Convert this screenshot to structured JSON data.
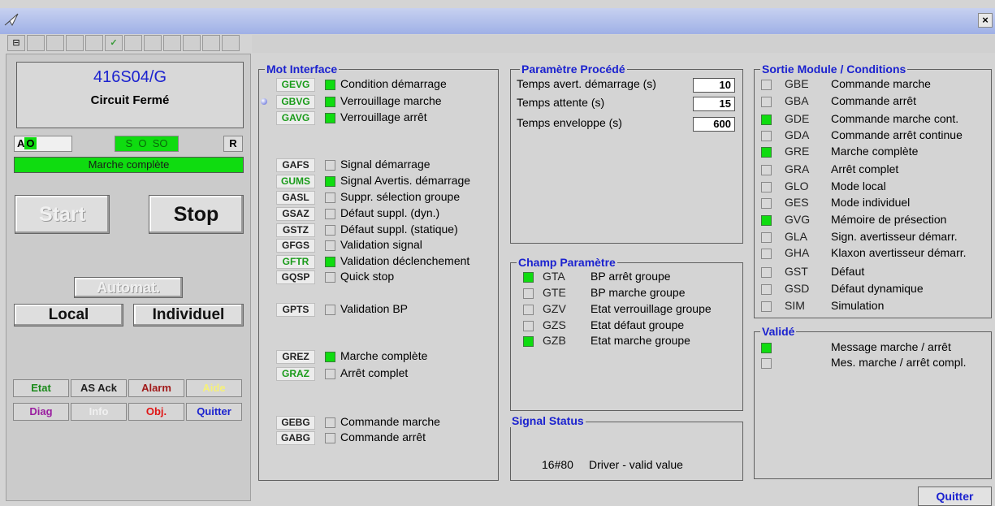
{
  "toolbar": {
    "check_symbol": "✓"
  },
  "left": {
    "title": "416S04/G",
    "subtitle": "Circuit Fermé",
    "ao": {
      "a": "A",
      "o": "O"
    },
    "so": {
      "s": "S",
      "o": "O",
      "so": "SO"
    },
    "r": "R",
    "status": "Marche complète",
    "start": "Start",
    "stop": "Stop",
    "automat": "Automat.",
    "local": "Local",
    "individuel": "Individuel",
    "grid": [
      {
        "label": "Etat",
        "color": "#1a8a1a"
      },
      {
        "label": "AS Ack",
        "color": "#222222"
      },
      {
        "label": "Alarm",
        "color": "#a11b1b"
      },
      {
        "label": "Aide",
        "color": "#f5f07a"
      },
      {
        "label": "Diag",
        "color": "#9a1ea0"
      },
      {
        "label": "Info",
        "color": "#f0f0f0"
      },
      {
        "label": "Obj.",
        "color": "#e01515"
      },
      {
        "label": "Quitter",
        "color": "#1b22cf"
      }
    ]
  },
  "mot": {
    "title": "Mot Interface",
    "rows": [
      {
        "code": "GEVG",
        "green": true,
        "checked": true,
        "label": "Condition démarrage"
      },
      {
        "code": "GBVG",
        "green": true,
        "checked": true,
        "label": "Verrouillage marche"
      },
      {
        "code": "GAVG",
        "green": true,
        "checked": true,
        "label": "Verrouillage arrêt"
      },
      {
        "code": "GAFS",
        "green": false,
        "checked": false,
        "label": "Signal démarrage"
      },
      {
        "code": "GUMS",
        "green": true,
        "checked": true,
        "label": "Signal Avertis. démarrage"
      },
      {
        "code": "GASL",
        "green": false,
        "checked": false,
        "label": "Suppr. sélection groupe"
      },
      {
        "code": "GSAZ",
        "green": false,
        "checked": false,
        "label": "Défaut suppl. (dyn.)"
      },
      {
        "code": "GSTZ",
        "green": false,
        "checked": false,
        "label": "Défaut suppl. (statique)"
      },
      {
        "code": "GFGS",
        "green": false,
        "checked": false,
        "label": "Validation signal"
      },
      {
        "code": "GFTR",
        "green": true,
        "checked": true,
        "label": "Validation déclenchement"
      },
      {
        "code": "GQSP",
        "green": false,
        "checked": false,
        "label": "Quick stop"
      },
      {
        "code": "GPTS",
        "green": false,
        "checked": false,
        "label": "Validation BP"
      },
      {
        "code": "GREZ",
        "green": false,
        "checked": true,
        "label": "Marche complète"
      },
      {
        "code": "GRAZ",
        "green": true,
        "checked": false,
        "label": "Arrêt complet"
      },
      {
        "code": "GEBG",
        "green": false,
        "checked": false,
        "label": "Commande marche"
      },
      {
        "code": "GABG",
        "green": false,
        "checked": false,
        "label": "Commande arrêt"
      }
    ]
  },
  "param": {
    "title": "Paramètre Procédé",
    "rows": [
      {
        "label": "Temps avert. démarrage (s)",
        "value": "10"
      },
      {
        "label": "Temps attente (s)",
        "value": "15"
      },
      {
        "label": "Temps enveloppe (s)",
        "value": "600"
      }
    ]
  },
  "champ": {
    "title": "Champ Paramètre",
    "rows": [
      {
        "code": "GTA",
        "checked": true,
        "label": "BP arrêt groupe"
      },
      {
        "code": "GTE",
        "checked": false,
        "label": "BP marche groupe"
      },
      {
        "code": "GZV",
        "checked": false,
        "label": "Etat verrouillage groupe"
      },
      {
        "code": "GZS",
        "checked": false,
        "label": "Etat défaut groupe"
      },
      {
        "code": "GZB",
        "checked": true,
        "label": "Etat marche groupe"
      }
    ]
  },
  "signal": {
    "title": "Signal Status",
    "value": "16#80",
    "text": "Driver - valid value"
  },
  "sortie": {
    "title": "Sortie Module  / Conditions",
    "rows": [
      {
        "code": "GBE",
        "checked": false,
        "label": "Commande marche"
      },
      {
        "code": "GBA",
        "checked": false,
        "label": "Commande arrêt"
      },
      {
        "code": "GDE",
        "checked": true,
        "label": "Commande marche cont."
      },
      {
        "code": "GDA",
        "checked": false,
        "label": "Commande arrêt continue"
      },
      {
        "code": "GRE",
        "checked": true,
        "label": "Marche complète"
      },
      {
        "code": "GRA",
        "checked": false,
        "label": "Arrêt complet"
      },
      {
        "code": "GLO",
        "checked": false,
        "label": "Mode local"
      },
      {
        "code": "GES",
        "checked": false,
        "label": "Mode individuel"
      },
      {
        "code": "GVG",
        "checked": true,
        "label": "Mémoire de présection"
      },
      {
        "code": "GLA",
        "checked": false,
        "label": "Sign. avertisseur démarr."
      },
      {
        "code": "GHA",
        "checked": false,
        "label": "Klaxon avertisseur démarr."
      },
      {
        "code": "GST",
        "checked": false,
        "label": "Défaut"
      },
      {
        "code": "GSD",
        "checked": false,
        "label": "Défaut dynamique"
      },
      {
        "code": "SIM",
        "checked": false,
        "label": "Simulation"
      }
    ]
  },
  "valide": {
    "title": "Validé",
    "rows": [
      {
        "checked": true,
        "label": "Message marche / arrêt"
      },
      {
        "checked": false,
        "label": "Mes. marche / arrêt compl."
      }
    ]
  },
  "quitter": "Quitter"
}
